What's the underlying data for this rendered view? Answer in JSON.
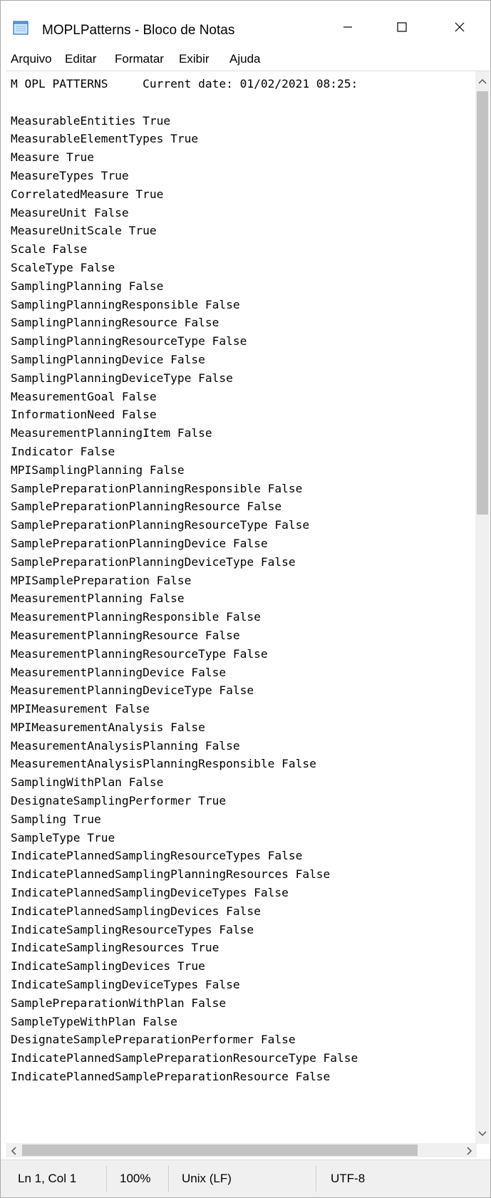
{
  "window": {
    "title": "MOPLPatterns - Bloco de Notas",
    "icon": "notepad-icon",
    "controls": {
      "minimize": "minimize-icon",
      "maximize": "maximize-icon",
      "close": "close-icon"
    }
  },
  "menu": {
    "items": [
      {
        "label": "Arquivo"
      },
      {
        "label": "Editar"
      },
      {
        "label": "Formatar"
      },
      {
        "label": "Exibir"
      },
      {
        "label": "Ajuda"
      }
    ]
  },
  "document": {
    "lines": [
      "M OPL PATTERNS     Current date: 01/02/2021 08:25:",
      "",
      "MeasurableEntities True",
      "MeasurableElementTypes True",
      "Measure True",
      "MeasureTypes True",
      "CorrelatedMeasure True",
      "MeasureUnit False",
      "MeasureUnitScale True",
      "Scale False",
      "ScaleType False",
      "SamplingPlanning False",
      "SamplingPlanningResponsible False",
      "SamplingPlanningResource False",
      "SamplingPlanningResourceType False",
      "SamplingPlanningDevice False",
      "SamplingPlanningDeviceType False",
      "MeasurementGoal False",
      "InformationNeed False",
      "MeasurementPlanningItem False",
      "Indicator False",
      "MPISamplingPlanning False",
      "SamplePreparationPlanningResponsible False",
      "SamplePreparationPlanningResource False",
      "SamplePreparationPlanningResourceType False",
      "SamplePreparationPlanningDevice False",
      "SamplePreparationPlanningDeviceType False",
      "MPISamplePreparation False",
      "MeasurementPlanning False",
      "MeasurementPlanningResponsible False",
      "MeasurementPlanningResource False",
      "MeasurementPlanningResourceType False",
      "MeasurementPlanningDevice False",
      "MeasurementPlanningDeviceType False",
      "MPIMeasurement False",
      "MPIMeasurementAnalysis False",
      "MeasurementAnalysisPlanning False",
      "MeasurementAnalysisPlanningResponsible False",
      "SamplingWithPlan False",
      "DesignateSamplingPerformer True",
      "Sampling True",
      "SampleType True",
      "IndicatePlannedSamplingResourceTypes False",
      "IndicatePlannedSamplingPlanningResources False",
      "IndicatePlannedSamplingDeviceTypes False",
      "IndicatePlannedSamplingDevices False",
      "IndicateSamplingResourceTypes False",
      "IndicateSamplingResources True",
      "IndicateSamplingDevices True",
      "IndicateSamplingDeviceTypes False",
      "SamplePreparationWithPlan False",
      "SampleTypeWithPlan False",
      "DesignateSamplePreparationPerformer False",
      "IndicatePlannedSamplePreparationResourceType False",
      "IndicatePlannedSamplePreparationResource False"
    ]
  },
  "scrollbars": {
    "vertical": {
      "up": "chevron-up-icon",
      "down": "chevron-down-icon"
    },
    "horizontal": {
      "left": "chevron-left-icon",
      "right": "chevron-right-icon"
    }
  },
  "status": {
    "position": "Ln 1, Col 1",
    "zoom": "100%",
    "line_ending": "Unix (LF)",
    "encoding": "UTF-8"
  }
}
